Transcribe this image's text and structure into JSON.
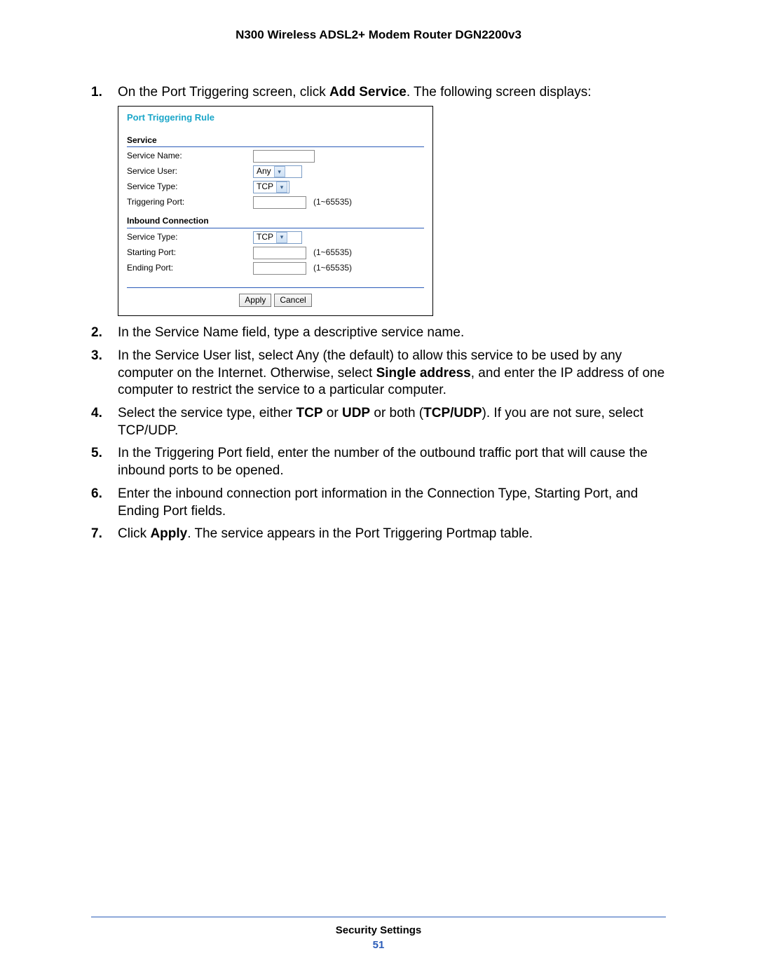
{
  "header": {
    "title": "N300 Wireless ADSL2+ Modem Router DGN2200v3"
  },
  "steps": [
    {
      "num": "1.",
      "pre": "On the Port Triggering screen, click ",
      "bold1": "Add Service",
      "post": ". The following screen displays:"
    },
    {
      "num": "2.",
      "text": "In the Service Name field, type a descriptive service name."
    },
    {
      "num": "3.",
      "pre": "In the Service User list, select Any (the default) to allow this service to be used by any computer on the Internet. Otherwise, select ",
      "bold1": "Single address",
      "post": ", and enter the IP address of one computer to restrict the service to a particular computer."
    },
    {
      "num": "4.",
      "pre": "Select the service type, either ",
      "bold1": "TCP",
      "mid1": " or ",
      "bold2": "UDP",
      "mid2": " or both (",
      "bold3": "TCP/UDP",
      "post": "). If you are not sure, select TCP/UDP."
    },
    {
      "num": "5.",
      "text": "In the Triggering Port field, enter the number of the outbound traffic port that will cause the inbound ports to be opened."
    },
    {
      "num": "6.",
      "text": "Enter the inbound connection port information in the Connection Type, Starting Port, and Ending Port fields."
    },
    {
      "num": "7.",
      "pre": "Click ",
      "bold1": "Apply",
      "post": ". The service appears in the Port Triggering Portmap table."
    }
  ],
  "shot": {
    "title": "Port Triggering Rule",
    "section1": "Service",
    "rows1": {
      "service_name_label": "Service Name:",
      "service_user_label": "Service User:",
      "service_user_value": "Any",
      "service_type_label": "Service Type:",
      "service_type_value": "TCP",
      "triggering_port_label": "Triggering Port:",
      "port_hint": "(1~65535)"
    },
    "section2": "Inbound Connection",
    "rows2": {
      "service_type_label": "Service Type:",
      "service_type_value": "TCP",
      "starting_port_label": "Starting Port:",
      "ending_port_label": "Ending Port:",
      "port_hint1": "(1~65535)",
      "port_hint2": "(1~65535)"
    },
    "buttons": {
      "apply": "Apply",
      "cancel": "Cancel"
    }
  },
  "footer": {
    "section": "Security Settings",
    "page": "51"
  }
}
